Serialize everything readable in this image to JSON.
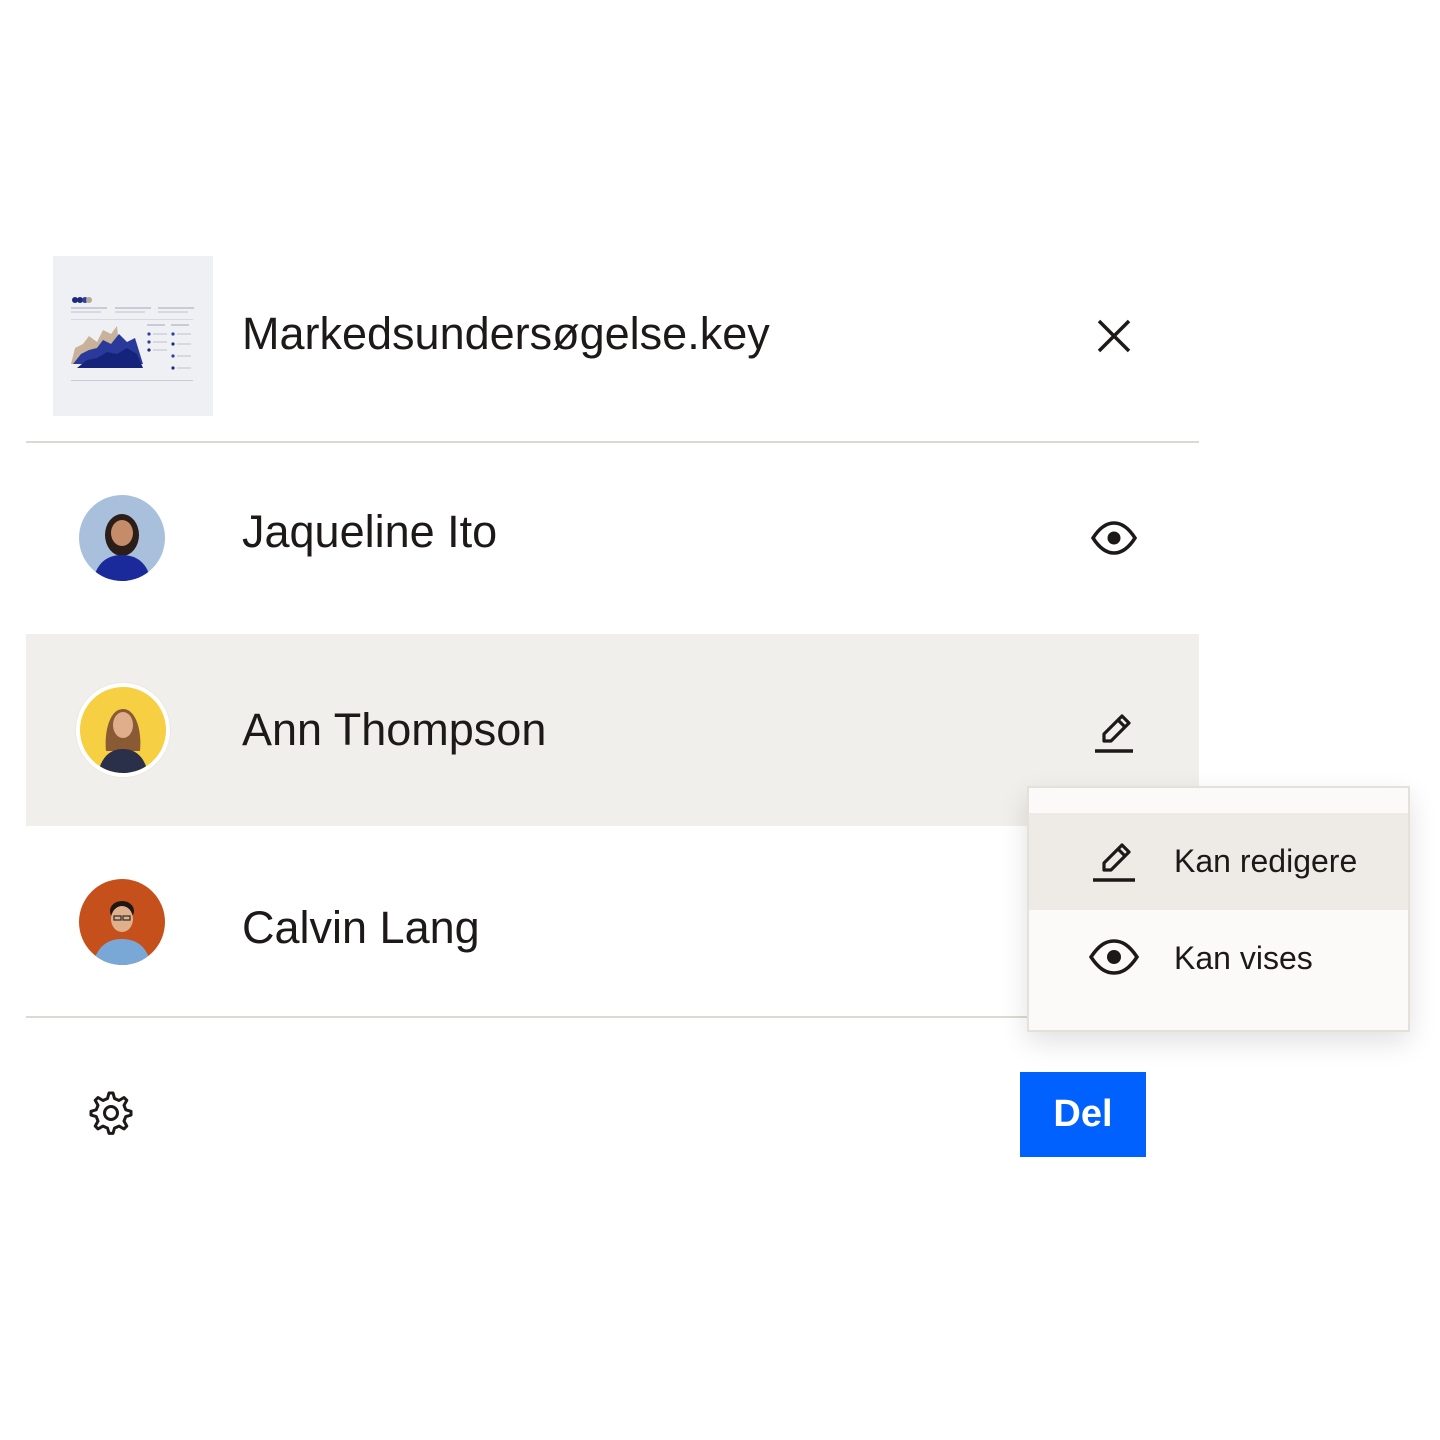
{
  "file": {
    "name": "Markedsundersøgelse.key",
    "thumbnail_icon": "keynote-presentation-thumbnail"
  },
  "members": [
    {
      "name": "Jaqueline Ito",
      "permission_icon": "eye-icon",
      "avatar_bg": "#a9c0dc",
      "shirt": "#1b2a9a"
    },
    {
      "name": "Ann Thompson",
      "permission_icon": "pencil-icon",
      "avatar_bg": "#f6cf43",
      "shirt": "#2a2f4a",
      "selected": true
    },
    {
      "name": "Calvin Lang",
      "permission_icon": "eye-icon",
      "avatar_bg": "#c5501b",
      "shirt": "#7aa8d6"
    }
  ],
  "permission_menu": {
    "items": [
      {
        "label": "Kan redigere",
        "icon": "pencil-icon",
        "active": true
      },
      {
        "label": "Kan vises",
        "icon": "eye-icon",
        "active": false
      }
    ]
  },
  "footer": {
    "share_label": "Del",
    "settings_icon": "gear-icon"
  },
  "colors": {
    "accent": "#0061fe",
    "selected_row": "#f1efeb",
    "divider": "#dcd9d4",
    "text": "#1e1919"
  }
}
